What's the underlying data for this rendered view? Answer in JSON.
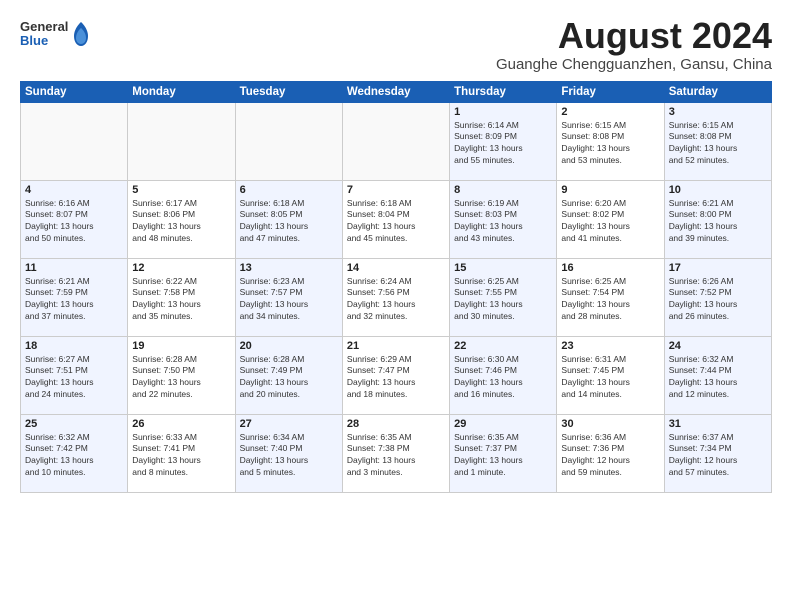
{
  "header": {
    "logo_line1": "General",
    "logo_line2": "Blue",
    "month_year": "August 2024",
    "location": "Guanghe Chengguanzhen, Gansu, China"
  },
  "days_of_week": [
    "Sunday",
    "Monday",
    "Tuesday",
    "Wednesday",
    "Thursday",
    "Friday",
    "Saturday"
  ],
  "weeks": [
    [
      {
        "day": "",
        "info": ""
      },
      {
        "day": "",
        "info": ""
      },
      {
        "day": "",
        "info": ""
      },
      {
        "day": "",
        "info": ""
      },
      {
        "day": "1",
        "info": "Sunrise: 6:14 AM\nSunset: 8:09 PM\nDaylight: 13 hours\nand 55 minutes."
      },
      {
        "day": "2",
        "info": "Sunrise: 6:15 AM\nSunset: 8:08 PM\nDaylight: 13 hours\nand 53 minutes."
      },
      {
        "day": "3",
        "info": "Sunrise: 6:15 AM\nSunset: 8:08 PM\nDaylight: 13 hours\nand 52 minutes."
      }
    ],
    [
      {
        "day": "4",
        "info": "Sunrise: 6:16 AM\nSunset: 8:07 PM\nDaylight: 13 hours\nand 50 minutes."
      },
      {
        "day": "5",
        "info": "Sunrise: 6:17 AM\nSunset: 8:06 PM\nDaylight: 13 hours\nand 48 minutes."
      },
      {
        "day": "6",
        "info": "Sunrise: 6:18 AM\nSunset: 8:05 PM\nDaylight: 13 hours\nand 47 minutes."
      },
      {
        "day": "7",
        "info": "Sunrise: 6:18 AM\nSunset: 8:04 PM\nDaylight: 13 hours\nand 45 minutes."
      },
      {
        "day": "8",
        "info": "Sunrise: 6:19 AM\nSunset: 8:03 PM\nDaylight: 13 hours\nand 43 minutes."
      },
      {
        "day": "9",
        "info": "Sunrise: 6:20 AM\nSunset: 8:02 PM\nDaylight: 13 hours\nand 41 minutes."
      },
      {
        "day": "10",
        "info": "Sunrise: 6:21 AM\nSunset: 8:00 PM\nDaylight: 13 hours\nand 39 minutes."
      }
    ],
    [
      {
        "day": "11",
        "info": "Sunrise: 6:21 AM\nSunset: 7:59 PM\nDaylight: 13 hours\nand 37 minutes."
      },
      {
        "day": "12",
        "info": "Sunrise: 6:22 AM\nSunset: 7:58 PM\nDaylight: 13 hours\nand 35 minutes."
      },
      {
        "day": "13",
        "info": "Sunrise: 6:23 AM\nSunset: 7:57 PM\nDaylight: 13 hours\nand 34 minutes."
      },
      {
        "day": "14",
        "info": "Sunrise: 6:24 AM\nSunset: 7:56 PM\nDaylight: 13 hours\nand 32 minutes."
      },
      {
        "day": "15",
        "info": "Sunrise: 6:25 AM\nSunset: 7:55 PM\nDaylight: 13 hours\nand 30 minutes."
      },
      {
        "day": "16",
        "info": "Sunrise: 6:25 AM\nSunset: 7:54 PM\nDaylight: 13 hours\nand 28 minutes."
      },
      {
        "day": "17",
        "info": "Sunrise: 6:26 AM\nSunset: 7:52 PM\nDaylight: 13 hours\nand 26 minutes."
      }
    ],
    [
      {
        "day": "18",
        "info": "Sunrise: 6:27 AM\nSunset: 7:51 PM\nDaylight: 13 hours\nand 24 minutes."
      },
      {
        "day": "19",
        "info": "Sunrise: 6:28 AM\nSunset: 7:50 PM\nDaylight: 13 hours\nand 22 minutes."
      },
      {
        "day": "20",
        "info": "Sunrise: 6:28 AM\nSunset: 7:49 PM\nDaylight: 13 hours\nand 20 minutes."
      },
      {
        "day": "21",
        "info": "Sunrise: 6:29 AM\nSunset: 7:47 PM\nDaylight: 13 hours\nand 18 minutes."
      },
      {
        "day": "22",
        "info": "Sunrise: 6:30 AM\nSunset: 7:46 PM\nDaylight: 13 hours\nand 16 minutes."
      },
      {
        "day": "23",
        "info": "Sunrise: 6:31 AM\nSunset: 7:45 PM\nDaylight: 13 hours\nand 14 minutes."
      },
      {
        "day": "24",
        "info": "Sunrise: 6:32 AM\nSunset: 7:44 PM\nDaylight: 13 hours\nand 12 minutes."
      }
    ],
    [
      {
        "day": "25",
        "info": "Sunrise: 6:32 AM\nSunset: 7:42 PM\nDaylight: 13 hours\nand 10 minutes."
      },
      {
        "day": "26",
        "info": "Sunrise: 6:33 AM\nSunset: 7:41 PM\nDaylight: 13 hours\nand 8 minutes."
      },
      {
        "day": "27",
        "info": "Sunrise: 6:34 AM\nSunset: 7:40 PM\nDaylight: 13 hours\nand 5 minutes."
      },
      {
        "day": "28",
        "info": "Sunrise: 6:35 AM\nSunset: 7:38 PM\nDaylight: 13 hours\nand 3 minutes."
      },
      {
        "day": "29",
        "info": "Sunrise: 6:35 AM\nSunset: 7:37 PM\nDaylight: 13 hours\nand 1 minute."
      },
      {
        "day": "30",
        "info": "Sunrise: 6:36 AM\nSunset: 7:36 PM\nDaylight: 12 hours\nand 59 minutes."
      },
      {
        "day": "31",
        "info": "Sunrise: 6:37 AM\nSunset: 7:34 PM\nDaylight: 12 hours\nand 57 minutes."
      }
    ]
  ]
}
